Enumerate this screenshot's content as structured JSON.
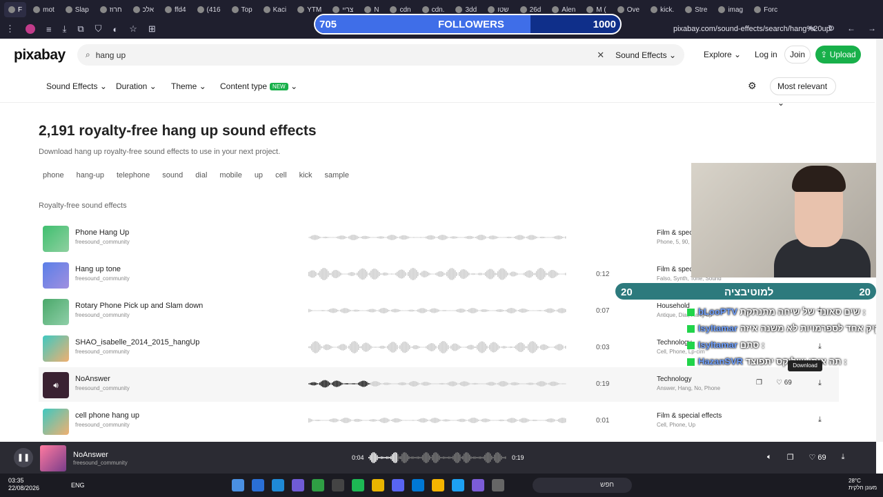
{
  "browser": {
    "tabs": [
      "F",
      "mot",
      "Slap",
      "חרוז",
      "אלכ",
      "ffd4",
      "(416",
      "Top",
      "Kaci",
      "YTM",
      "צריי",
      "N",
      "cdn",
      "cdn.",
      "3dd",
      "שטו",
      "26d",
      "Alen",
      "M (",
      "Ove",
      "kick.",
      "Stre",
      "imag",
      "Forc"
    ],
    "url": "pixabay.com/sound-effects/search/hang%20up/"
  },
  "stream_overlay": {
    "followers_label": "FOLLOWERS",
    "followers_current": "705",
    "followers_goal": "1000",
    "followers_progress": 0.705,
    "motivation_label": "למוטיבציה",
    "motivation_left": "20",
    "motivation_right": "20",
    "chat": [
      {
        "name": "bLooPTV",
        "text": "שים סאונד של שיחה מתנתקת :"
      },
      {
        "name": "IsyItamar",
        "text": "קיק אחד לספרמויות לא משנה איזה :"
      },
      {
        "name": "IsyItamar",
        "text": "סתם :"
      },
      {
        "name": "HazanSVR",
        "text": "תה איתן שילוקס יתפוצד :"
      }
    ]
  },
  "header": {
    "logo": "pixabay",
    "search_value": "hang up",
    "search_category": "Sound Effects",
    "explore": "Explore",
    "login": "Log in",
    "join": "Join",
    "upload": "Upload"
  },
  "filters": {
    "items": [
      "Sound Effects",
      "Duration",
      "Theme",
      "Content type"
    ],
    "new_badge": "NEW",
    "sort": "Most relevant"
  },
  "main": {
    "title": "2,191 royalty-free hang up sound effects",
    "subtitle": "Download hang up royalty-free sound effects to use in your next project.",
    "tags": [
      "phone",
      "hang-up",
      "telephone",
      "sound",
      "dial",
      "mobile",
      "up",
      "cell",
      "kick",
      "sample"
    ],
    "section_label": "Royalty-free sound effects",
    "download_tooltip": "Download"
  },
  "results": [
    {
      "title": "Phone Hang Up",
      "author": "freesound_community",
      "duration": "",
      "category": "Film & spec",
      "tags": "Phone, 5, 90,",
      "color1": "#3fbf6f",
      "color2": "#8fd0a0"
    },
    {
      "title": "Hang up tone",
      "author": "freesound_community",
      "duration": "0:12",
      "category": "Film & spec",
      "tags": "Falso, Synth, Tone, Sound",
      "color1": "#5a7fe8",
      "color2": "#a08fe0"
    },
    {
      "title": "Rotary Phone Pick up and Slam down",
      "author": "freesound_community",
      "duration": "0:07",
      "category": "Household",
      "tags": "Antique, Dial, Hang-up",
      "color1": "#4aa86a",
      "color2": "#8fcfa8"
    },
    {
      "title": "SHAO_isabelle_2014_2015_hangUp",
      "author": "freesound_community",
      "duration": "0:03",
      "category": "Technology",
      "tags": "Cell, Phone, Lp-cim",
      "color1": "#3fc8c0",
      "color2": "#f0b070"
    },
    {
      "title": "NoAnswer",
      "author": "freesound_community",
      "duration": "0:19",
      "category": "Technology",
      "tags": "Answer, Hang, No, Phone",
      "likes": "69",
      "color1": "#3a2232",
      "color2": "#3a2232"
    },
    {
      "title": "cell phone hang up",
      "author": "freesound_community",
      "duration": "0:01",
      "category": "Film & special effects",
      "tags": "Cell, Phone, Up",
      "color1": "#3fc8c0",
      "color2": "#f0b070"
    }
  ],
  "player": {
    "title": "NoAnswer",
    "author": "freesound_community",
    "current": "0:04",
    "total": "0:19",
    "progress": 0.21,
    "likes": "69"
  },
  "taskbar": {
    "time": "03:35",
    "date": "22/08/2026",
    "lang": "ENG",
    "search": "חפש",
    "temp": "28°C",
    "weather": "מעונן חלקית"
  }
}
